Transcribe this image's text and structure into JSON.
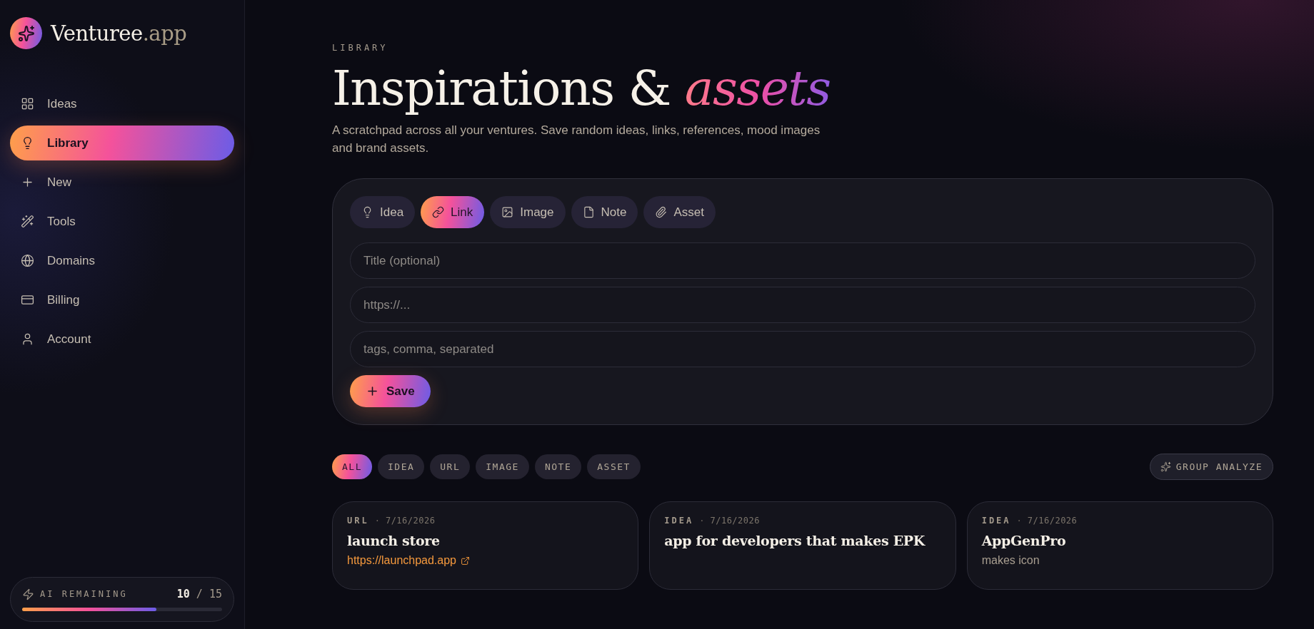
{
  "sidebar": {
    "logo": {
      "name": "Venturee",
      "suffix": ".app"
    },
    "items": [
      {
        "label": "Ideas",
        "selected": false
      },
      {
        "label": "Library",
        "selected": true
      },
      {
        "label": "New",
        "selected": false
      },
      {
        "label": "Tools",
        "selected": false
      },
      {
        "label": "Domains",
        "selected": false
      },
      {
        "label": "Billing",
        "selected": false
      },
      {
        "label": "Account",
        "selected": false
      }
    ],
    "ai_remaining": {
      "label": "AI REMAINING",
      "used": "10",
      "separator": "/",
      "total": "15",
      "level": 0.67
    }
  },
  "header": {
    "eyebrow": "LIBRARY",
    "title": "Inspirations &",
    "title_accent": "assets",
    "subtitle": "A scratchpad across all your ventures. Save random ideas, links, references, mood images and brand assets."
  },
  "composer": {
    "types": [
      {
        "label": "Idea",
        "selected": false
      },
      {
        "label": "Link",
        "selected": true
      },
      {
        "label": "Image",
        "selected": false
      },
      {
        "label": "Note",
        "selected": false
      },
      {
        "label": "Asset",
        "selected": false
      }
    ],
    "fields": [
      {
        "placeholder": "Title (optional)"
      },
      {
        "placeholder": "https://..."
      },
      {
        "placeholder": "tags, comma, separated"
      }
    ],
    "save_button": "Save"
  },
  "filters": [
    {
      "label": "ALL",
      "selected": true
    },
    {
      "label": "IDEA",
      "selected": false
    },
    {
      "label": "URL",
      "selected": false
    },
    {
      "label": "IMAGE",
      "selected": false
    },
    {
      "label": "NOTE",
      "selected": false
    },
    {
      "label": "ASSET",
      "selected": false
    }
  ],
  "group_analyze": "GROUP ANALYZE",
  "cards": [
    {
      "kind": "link",
      "type_label": "URL",
      "separator": "·",
      "date": "7/16/2026",
      "title": "launch store",
      "body": "https://launchpad.app"
    },
    {
      "kind": "text",
      "type_label": "IDEA",
      "separator": "·",
      "date": "7/16/2026",
      "title": "app for developers that makes EPK"
    },
    {
      "kind": "text",
      "type_label": "IDEA",
      "separator": "·",
      "date": "7/16/2026",
      "title": "AppGenPro",
      "body": "makes icon"
    }
  ]
}
